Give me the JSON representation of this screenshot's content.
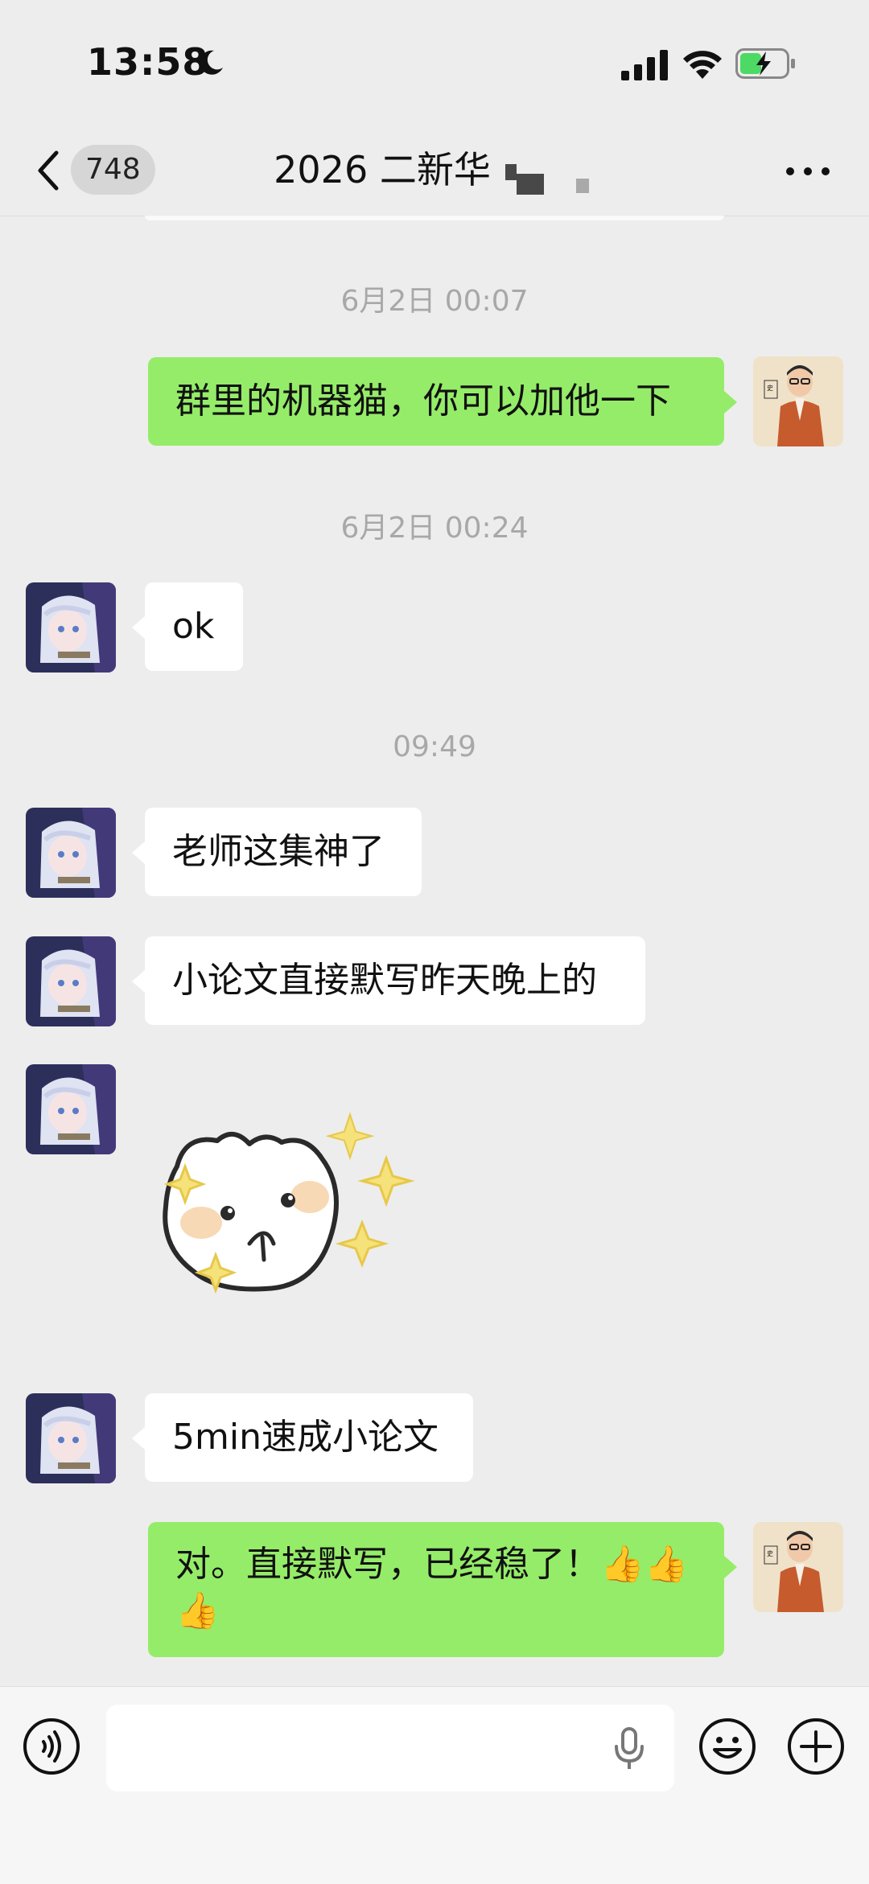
{
  "status_bar": {
    "time": "13:58",
    "battery_color": "#4cd964"
  },
  "nav": {
    "unread_count": "748",
    "title": "2026 二新华"
  },
  "messages": [
    {
      "type": "timestamp",
      "text": "6月2日 00:07"
    },
    {
      "type": "outgoing",
      "text": "群里的机器猫，你可以加他一下"
    },
    {
      "type": "timestamp",
      "text": "6月2日 00:24"
    },
    {
      "type": "incoming",
      "text": "ok"
    },
    {
      "type": "timestamp",
      "text": "09:49"
    },
    {
      "type": "incoming",
      "text": "老师这集神了"
    },
    {
      "type": "incoming",
      "text": "小论文直接默写昨天晚上的"
    },
    {
      "type": "incoming",
      "sticker": "sparkle-cat-sticker"
    },
    {
      "type": "incoming",
      "text": "5min速成小论文"
    },
    {
      "type": "outgoing",
      "text_line1": "对。直接默写，已经稳了！👍👍",
      "text_line2": "👍"
    }
  ],
  "input_bar": {
    "voice_icon": "voice-toggle-icon",
    "mic_icon": "microphone-icon",
    "emoji_icon": "emoji-icon",
    "plus_icon": "plus-icon"
  },
  "colors": {
    "outgoing_bubble": "#95ec69",
    "incoming_bubble": "#ffffff",
    "background": "#ededed"
  }
}
